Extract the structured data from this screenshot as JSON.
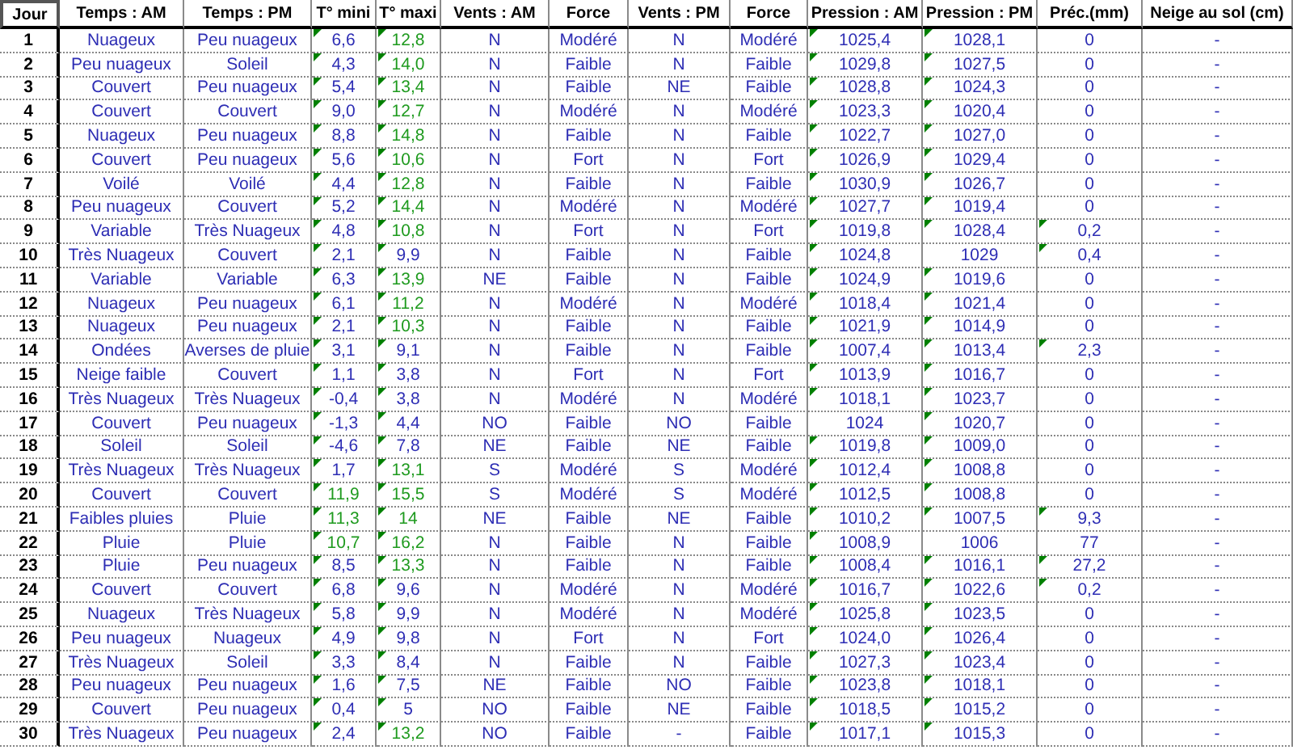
{
  "columns": [
    {
      "label": "Jour",
      "kind": "day"
    },
    {
      "label": "Temps : AM",
      "kind": "text"
    },
    {
      "label": "Temps : PM",
      "kind": "text"
    },
    {
      "label": "T° mini",
      "kind": "tmin"
    },
    {
      "label": "T° maxi",
      "kind": "tmax"
    },
    {
      "label": "Vents : AM",
      "kind": "text"
    },
    {
      "label": "Force",
      "kind": "text"
    },
    {
      "label": "Vents : PM",
      "kind": "text"
    },
    {
      "label": "Force",
      "kind": "text"
    },
    {
      "label": "Pression : AM",
      "kind": "pam"
    },
    {
      "label": "Pression : PM",
      "kind": "ppm"
    },
    {
      "label": "Préc.(mm)",
      "kind": "prec"
    },
    {
      "label": "Neige au sol (cm)",
      "kind": "text"
    }
  ],
  "rows": [
    {
      "cells": [
        "1",
        "Nuageux",
        "Peu nuageux",
        "6,6",
        "12,8",
        "N",
        "Modéré",
        "N",
        "Modéré",
        "1025,4",
        "1028,1",
        "0",
        "-"
      ],
      "warm_min": false,
      "warm_max": true,
      "flag_min": true,
      "flag_max": true,
      "flag_pam": true,
      "flag_ppm": true,
      "flag_prec": false
    },
    {
      "cells": [
        "2",
        "Peu nuageux",
        "Soleil",
        "4,3",
        "14,0",
        "N",
        "Faible",
        "N",
        "Faible",
        "1029,8",
        "1027,5",
        "0",
        "-"
      ],
      "warm_min": false,
      "warm_max": true,
      "flag_min": true,
      "flag_max": true,
      "flag_pam": true,
      "flag_ppm": true,
      "flag_prec": false
    },
    {
      "cells": [
        "3",
        "Couvert",
        "Peu nuageux",
        "5,4",
        "13,4",
        "N",
        "Faible",
        "NE",
        "Faible",
        "1028,8",
        "1024,3",
        "0",
        "-"
      ],
      "warm_min": false,
      "warm_max": true,
      "flag_min": true,
      "flag_max": true,
      "flag_pam": true,
      "flag_ppm": true,
      "flag_prec": false
    },
    {
      "cells": [
        "4",
        "Couvert",
        "Couvert",
        "9,0",
        "12,7",
        "N",
        "Modéré",
        "N",
        "Modéré",
        "1023,3",
        "1020,4",
        "0",
        "-"
      ],
      "warm_min": false,
      "warm_max": true,
      "flag_min": true,
      "flag_max": true,
      "flag_pam": true,
      "flag_ppm": true,
      "flag_prec": false
    },
    {
      "cells": [
        "5",
        "Nuageux",
        "Peu nuageux",
        "8,8",
        "14,8",
        "N",
        "Faible",
        "N",
        "Faible",
        "1022,7",
        "1027,0",
        "0",
        "-"
      ],
      "warm_min": false,
      "warm_max": true,
      "flag_min": true,
      "flag_max": true,
      "flag_pam": true,
      "flag_ppm": true,
      "flag_prec": false
    },
    {
      "cells": [
        "6",
        "Couvert",
        "Peu nuageux",
        "5,6",
        "10,6",
        "N",
        "Fort",
        "N",
        "Fort",
        "1026,9",
        "1029,4",
        "0",
        "-"
      ],
      "warm_min": false,
      "warm_max": true,
      "flag_min": true,
      "flag_max": true,
      "flag_pam": true,
      "flag_ppm": true,
      "flag_prec": false
    },
    {
      "cells": [
        "7",
        "Voilé",
        "Voilé",
        "4,4",
        "12,8",
        "N",
        "Faible",
        "N",
        "Faible",
        "1030,9",
        "1026,7",
        "0",
        "-"
      ],
      "warm_min": false,
      "warm_max": true,
      "flag_min": true,
      "flag_max": true,
      "flag_pam": true,
      "flag_ppm": true,
      "flag_prec": false
    },
    {
      "cells": [
        "8",
        "Peu nuageux",
        "Couvert",
        "5,2",
        "14,4",
        "N",
        "Modéré",
        "N",
        "Modéré",
        "1027,7",
        "1019,4",
        "0",
        "-"
      ],
      "warm_min": false,
      "warm_max": true,
      "flag_min": true,
      "flag_max": true,
      "flag_pam": true,
      "flag_ppm": true,
      "flag_prec": false
    },
    {
      "cells": [
        "9",
        "Variable",
        "Très Nuageux",
        "4,8",
        "10,8",
        "N",
        "Fort",
        "N",
        "Fort",
        "1019,8",
        "1028,4",
        "0,2",
        "-"
      ],
      "warm_min": false,
      "warm_max": true,
      "flag_min": true,
      "flag_max": true,
      "flag_pam": true,
      "flag_ppm": true,
      "flag_prec": true
    },
    {
      "cells": [
        "10",
        "Très Nuageux",
        "Couvert",
        "2,1",
        "9,9",
        "N",
        "Faible",
        "N",
        "Faible",
        "1024,8",
        "1029",
        "0,4",
        "-"
      ],
      "warm_min": false,
      "warm_max": false,
      "flag_min": true,
      "flag_max": true,
      "flag_pam": true,
      "flag_ppm": false,
      "flag_prec": true
    },
    {
      "cells": [
        "11",
        "Variable",
        "Variable",
        "6,3",
        "13,9",
        "NE",
        "Faible",
        "N",
        "Faible",
        "1024,9",
        "1019,6",
        "0",
        "-"
      ],
      "warm_min": false,
      "warm_max": true,
      "flag_min": true,
      "flag_max": true,
      "flag_pam": true,
      "flag_ppm": true,
      "flag_prec": false
    },
    {
      "cells": [
        "12",
        "Nuageux",
        "Peu nuageux",
        "6,1",
        "11,2",
        "N",
        "Modéré",
        "N",
        "Modéré",
        "1018,4",
        "1021,4",
        "0",
        "-"
      ],
      "warm_min": false,
      "warm_max": true,
      "flag_min": true,
      "flag_max": true,
      "flag_pam": true,
      "flag_ppm": true,
      "flag_prec": false
    },
    {
      "cells": [
        "13",
        "Nuageux",
        "Peu nuageux",
        "2,1",
        "10,3",
        "N",
        "Faible",
        "N",
        "Faible",
        "1021,9",
        "1014,9",
        "0",
        "-"
      ],
      "warm_min": false,
      "warm_max": true,
      "flag_min": true,
      "flag_max": true,
      "flag_pam": true,
      "flag_ppm": true,
      "flag_prec": false
    },
    {
      "cells": [
        "14",
        "Ondées",
        "Averses de pluie",
        "3,1",
        "9,1",
        "N",
        "Faible",
        "N",
        "Faible",
        "1007,4",
        "1013,4",
        "2,3",
        "-"
      ],
      "warm_min": false,
      "warm_max": false,
      "flag_min": true,
      "flag_max": true,
      "flag_pam": true,
      "flag_ppm": true,
      "flag_prec": true
    },
    {
      "cells": [
        "15",
        "Neige faible",
        "Couvert",
        "1,1",
        "3,8",
        "N",
        "Fort",
        "N",
        "Fort",
        "1013,9",
        "1016,7",
        "0",
        "-"
      ],
      "warm_min": false,
      "warm_max": false,
      "flag_min": true,
      "flag_max": true,
      "flag_pam": true,
      "flag_ppm": true,
      "flag_prec": false
    },
    {
      "cells": [
        "16",
        "Très Nuageux",
        "Très Nuageux",
        "-0,4",
        "3,8",
        "N",
        "Modéré",
        "N",
        "Modéré",
        "1018,1",
        "1023,7",
        "0",
        "-"
      ],
      "warm_min": false,
      "warm_max": false,
      "flag_min": true,
      "flag_max": true,
      "flag_pam": true,
      "flag_ppm": true,
      "flag_prec": false
    },
    {
      "cells": [
        "17",
        "Couvert",
        "Peu nuageux",
        "-1,3",
        "4,4",
        "NO",
        "Faible",
        "NO",
        "Faible",
        "1024",
        "1020,7",
        "0",
        "-"
      ],
      "warm_min": false,
      "warm_max": false,
      "flag_min": true,
      "flag_max": true,
      "flag_pam": false,
      "flag_ppm": true,
      "flag_prec": false
    },
    {
      "cells": [
        "18",
        "Soleil",
        "Soleil",
        "-4,6",
        "7,8",
        "NE",
        "Faible",
        "NE",
        "Faible",
        "1019,8",
        "1009,0",
        "0",
        "-"
      ],
      "warm_min": false,
      "warm_max": false,
      "flag_min": true,
      "flag_max": true,
      "flag_pam": true,
      "flag_ppm": true,
      "flag_prec": false
    },
    {
      "cells": [
        "19",
        "Très Nuageux",
        "Très Nuageux",
        "1,7",
        "13,1",
        "S",
        "Modéré",
        "S",
        "Modéré",
        "1012,4",
        "1008,8",
        "0",
        "-"
      ],
      "warm_min": false,
      "warm_max": true,
      "flag_min": true,
      "flag_max": true,
      "flag_pam": true,
      "flag_ppm": true,
      "flag_prec": false
    },
    {
      "cells": [
        "20",
        "Couvert",
        "Couvert",
        "11,9",
        "15,5",
        "S",
        "Modéré",
        "S",
        "Modéré",
        "1012,5",
        "1008,8",
        "0",
        "-"
      ],
      "warm_min": true,
      "warm_max": true,
      "flag_min": true,
      "flag_max": true,
      "flag_pam": true,
      "flag_ppm": true,
      "flag_prec": false
    },
    {
      "cells": [
        "21",
        "Faibles pluies",
        "Pluie",
        "11,3",
        "14",
        "NE",
        "Faible",
        "NE",
        "Faible",
        "1010,2",
        "1007,5",
        "9,3",
        "-"
      ],
      "warm_min": true,
      "warm_max": true,
      "flag_min": true,
      "flag_max": true,
      "flag_pam": true,
      "flag_ppm": true,
      "flag_prec": true
    },
    {
      "cells": [
        "22",
        "Pluie",
        "Pluie",
        "10,7",
        "16,2",
        "N",
        "Faible",
        "N",
        "Faible",
        "1008,9",
        "1006",
        "77",
        "-"
      ],
      "warm_min": true,
      "warm_max": true,
      "flag_min": true,
      "flag_max": true,
      "flag_pam": true,
      "flag_ppm": false,
      "flag_prec": false
    },
    {
      "cells": [
        "23",
        "Pluie",
        "Peu nuageux",
        "8,5",
        "13,3",
        "N",
        "Faible",
        "N",
        "Faible",
        "1008,4",
        "1016,1",
        "27,2",
        "-"
      ],
      "warm_min": false,
      "warm_max": true,
      "flag_min": true,
      "flag_max": true,
      "flag_pam": true,
      "flag_ppm": true,
      "flag_prec": true
    },
    {
      "cells": [
        "24",
        "Couvert",
        "Couvert",
        "6,8",
        "9,6",
        "N",
        "Modéré",
        "N",
        "Modéré",
        "1016,7",
        "1022,6",
        "0,2",
        "-"
      ],
      "warm_min": false,
      "warm_max": false,
      "flag_min": true,
      "flag_max": true,
      "flag_pam": true,
      "flag_ppm": true,
      "flag_prec": true
    },
    {
      "cells": [
        "25",
        "Nuageux",
        "Très Nuageux",
        "5,8",
        "9,9",
        "N",
        "Modéré",
        "N",
        "Modéré",
        "1025,8",
        "1023,5",
        "0",
        "-"
      ],
      "warm_min": false,
      "warm_max": false,
      "flag_min": true,
      "flag_max": true,
      "flag_pam": true,
      "flag_ppm": true,
      "flag_prec": false
    },
    {
      "cells": [
        "26",
        "Peu nuageux",
        "Nuageux",
        "4,9",
        "9,8",
        "N",
        "Fort",
        "N",
        "Fort",
        "1024,0",
        "1026,4",
        "0",
        "-"
      ],
      "warm_min": false,
      "warm_max": false,
      "flag_min": true,
      "flag_max": true,
      "flag_pam": true,
      "flag_ppm": true,
      "flag_prec": false
    },
    {
      "cells": [
        "27",
        "Très Nuageux",
        "Soleil",
        "3,3",
        "8,4",
        "N",
        "Faible",
        "N",
        "Faible",
        "1027,3",
        "1023,4",
        "0",
        "-"
      ],
      "warm_min": false,
      "warm_max": false,
      "flag_min": true,
      "flag_max": true,
      "flag_pam": true,
      "flag_ppm": true,
      "flag_prec": false
    },
    {
      "cells": [
        "28",
        "Peu nuageux",
        "Peu nuageux",
        "1,6",
        "7,5",
        "NE",
        "Faible",
        "NO",
        "Faible",
        "1023,8",
        "1018,1",
        "0",
        "-"
      ],
      "warm_min": false,
      "warm_max": false,
      "flag_min": true,
      "flag_max": true,
      "flag_pam": true,
      "flag_ppm": true,
      "flag_prec": false
    },
    {
      "cells": [
        "29",
        "Couvert",
        "Peu nuageux",
        "0,4",
        "5",
        "NO",
        "Faible",
        "NE",
        "Faible",
        "1018,5",
        "1015,2",
        "0",
        "-"
      ],
      "warm_min": false,
      "warm_max": false,
      "flag_min": true,
      "flag_max": true,
      "flag_pam": true,
      "flag_ppm": true,
      "flag_prec": false
    },
    {
      "cells": [
        "30",
        "Très Nuageux",
        "Peu nuageux",
        "2,4",
        "13,2",
        "NO",
        "Faible",
        "-",
        "Faible",
        "1017,1",
        "1015,3",
        "0",
        "-"
      ],
      "warm_min": false,
      "warm_max": true,
      "flag_min": true,
      "flag_max": true,
      "flag_pam": true,
      "flag_ppm": true,
      "flag_prec": false
    }
  ]
}
